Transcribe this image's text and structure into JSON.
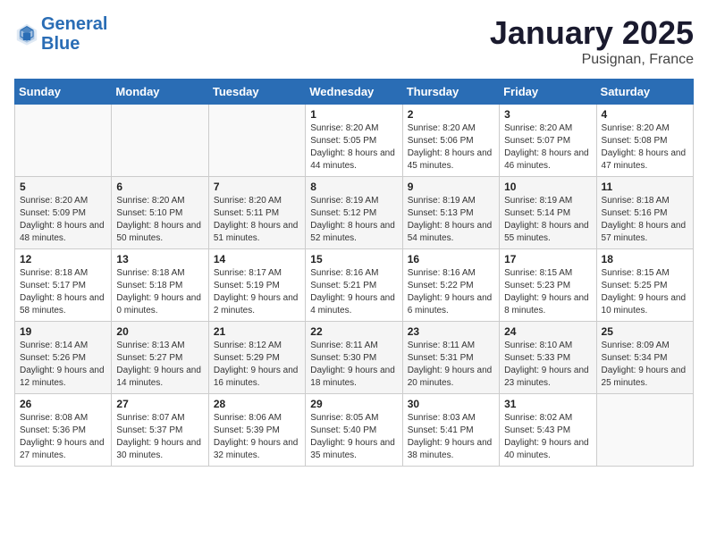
{
  "logo": {
    "line1": "General",
    "line2": "Blue"
  },
  "title": "January 2025",
  "location": "Pusignan, France",
  "days_header": [
    "Sunday",
    "Monday",
    "Tuesday",
    "Wednesday",
    "Thursday",
    "Friday",
    "Saturday"
  ],
  "weeks": [
    [
      {
        "day": "",
        "sunrise": "",
        "sunset": "",
        "daylight": ""
      },
      {
        "day": "",
        "sunrise": "",
        "sunset": "",
        "daylight": ""
      },
      {
        "day": "",
        "sunrise": "",
        "sunset": "",
        "daylight": ""
      },
      {
        "day": "1",
        "sunrise": "Sunrise: 8:20 AM",
        "sunset": "Sunset: 5:05 PM",
        "daylight": "Daylight: 8 hours and 44 minutes."
      },
      {
        "day": "2",
        "sunrise": "Sunrise: 8:20 AM",
        "sunset": "Sunset: 5:06 PM",
        "daylight": "Daylight: 8 hours and 45 minutes."
      },
      {
        "day": "3",
        "sunrise": "Sunrise: 8:20 AM",
        "sunset": "Sunset: 5:07 PM",
        "daylight": "Daylight: 8 hours and 46 minutes."
      },
      {
        "day": "4",
        "sunrise": "Sunrise: 8:20 AM",
        "sunset": "Sunset: 5:08 PM",
        "daylight": "Daylight: 8 hours and 47 minutes."
      }
    ],
    [
      {
        "day": "5",
        "sunrise": "Sunrise: 8:20 AM",
        "sunset": "Sunset: 5:09 PM",
        "daylight": "Daylight: 8 hours and 48 minutes."
      },
      {
        "day": "6",
        "sunrise": "Sunrise: 8:20 AM",
        "sunset": "Sunset: 5:10 PM",
        "daylight": "Daylight: 8 hours and 50 minutes."
      },
      {
        "day": "7",
        "sunrise": "Sunrise: 8:20 AM",
        "sunset": "Sunset: 5:11 PM",
        "daylight": "Daylight: 8 hours and 51 minutes."
      },
      {
        "day": "8",
        "sunrise": "Sunrise: 8:19 AM",
        "sunset": "Sunset: 5:12 PM",
        "daylight": "Daylight: 8 hours and 52 minutes."
      },
      {
        "day": "9",
        "sunrise": "Sunrise: 8:19 AM",
        "sunset": "Sunset: 5:13 PM",
        "daylight": "Daylight: 8 hours and 54 minutes."
      },
      {
        "day": "10",
        "sunrise": "Sunrise: 8:19 AM",
        "sunset": "Sunset: 5:14 PM",
        "daylight": "Daylight: 8 hours and 55 minutes."
      },
      {
        "day": "11",
        "sunrise": "Sunrise: 8:18 AM",
        "sunset": "Sunset: 5:16 PM",
        "daylight": "Daylight: 8 hours and 57 minutes."
      }
    ],
    [
      {
        "day": "12",
        "sunrise": "Sunrise: 8:18 AM",
        "sunset": "Sunset: 5:17 PM",
        "daylight": "Daylight: 8 hours and 58 minutes."
      },
      {
        "day": "13",
        "sunrise": "Sunrise: 8:18 AM",
        "sunset": "Sunset: 5:18 PM",
        "daylight": "Daylight: 9 hours and 0 minutes."
      },
      {
        "day": "14",
        "sunrise": "Sunrise: 8:17 AM",
        "sunset": "Sunset: 5:19 PM",
        "daylight": "Daylight: 9 hours and 2 minutes."
      },
      {
        "day": "15",
        "sunrise": "Sunrise: 8:16 AM",
        "sunset": "Sunset: 5:21 PM",
        "daylight": "Daylight: 9 hours and 4 minutes."
      },
      {
        "day": "16",
        "sunrise": "Sunrise: 8:16 AM",
        "sunset": "Sunset: 5:22 PM",
        "daylight": "Daylight: 9 hours and 6 minutes."
      },
      {
        "day": "17",
        "sunrise": "Sunrise: 8:15 AM",
        "sunset": "Sunset: 5:23 PM",
        "daylight": "Daylight: 9 hours and 8 minutes."
      },
      {
        "day": "18",
        "sunrise": "Sunrise: 8:15 AM",
        "sunset": "Sunset: 5:25 PM",
        "daylight": "Daylight: 9 hours and 10 minutes."
      }
    ],
    [
      {
        "day": "19",
        "sunrise": "Sunrise: 8:14 AM",
        "sunset": "Sunset: 5:26 PM",
        "daylight": "Daylight: 9 hours and 12 minutes."
      },
      {
        "day": "20",
        "sunrise": "Sunrise: 8:13 AM",
        "sunset": "Sunset: 5:27 PM",
        "daylight": "Daylight: 9 hours and 14 minutes."
      },
      {
        "day": "21",
        "sunrise": "Sunrise: 8:12 AM",
        "sunset": "Sunset: 5:29 PM",
        "daylight": "Daylight: 9 hours and 16 minutes."
      },
      {
        "day": "22",
        "sunrise": "Sunrise: 8:11 AM",
        "sunset": "Sunset: 5:30 PM",
        "daylight": "Daylight: 9 hours and 18 minutes."
      },
      {
        "day": "23",
        "sunrise": "Sunrise: 8:11 AM",
        "sunset": "Sunset: 5:31 PM",
        "daylight": "Daylight: 9 hours and 20 minutes."
      },
      {
        "day": "24",
        "sunrise": "Sunrise: 8:10 AM",
        "sunset": "Sunset: 5:33 PM",
        "daylight": "Daylight: 9 hours and 23 minutes."
      },
      {
        "day": "25",
        "sunrise": "Sunrise: 8:09 AM",
        "sunset": "Sunset: 5:34 PM",
        "daylight": "Daylight: 9 hours and 25 minutes."
      }
    ],
    [
      {
        "day": "26",
        "sunrise": "Sunrise: 8:08 AM",
        "sunset": "Sunset: 5:36 PM",
        "daylight": "Daylight: 9 hours and 27 minutes."
      },
      {
        "day": "27",
        "sunrise": "Sunrise: 8:07 AM",
        "sunset": "Sunset: 5:37 PM",
        "daylight": "Daylight: 9 hours and 30 minutes."
      },
      {
        "day": "28",
        "sunrise": "Sunrise: 8:06 AM",
        "sunset": "Sunset: 5:39 PM",
        "daylight": "Daylight: 9 hours and 32 minutes."
      },
      {
        "day": "29",
        "sunrise": "Sunrise: 8:05 AM",
        "sunset": "Sunset: 5:40 PM",
        "daylight": "Daylight: 9 hours and 35 minutes."
      },
      {
        "day": "30",
        "sunrise": "Sunrise: 8:03 AM",
        "sunset": "Sunset: 5:41 PM",
        "daylight": "Daylight: 9 hours and 38 minutes."
      },
      {
        "day": "31",
        "sunrise": "Sunrise: 8:02 AM",
        "sunset": "Sunset: 5:43 PM",
        "daylight": "Daylight: 9 hours and 40 minutes."
      },
      {
        "day": "",
        "sunrise": "",
        "sunset": "",
        "daylight": ""
      }
    ]
  ]
}
